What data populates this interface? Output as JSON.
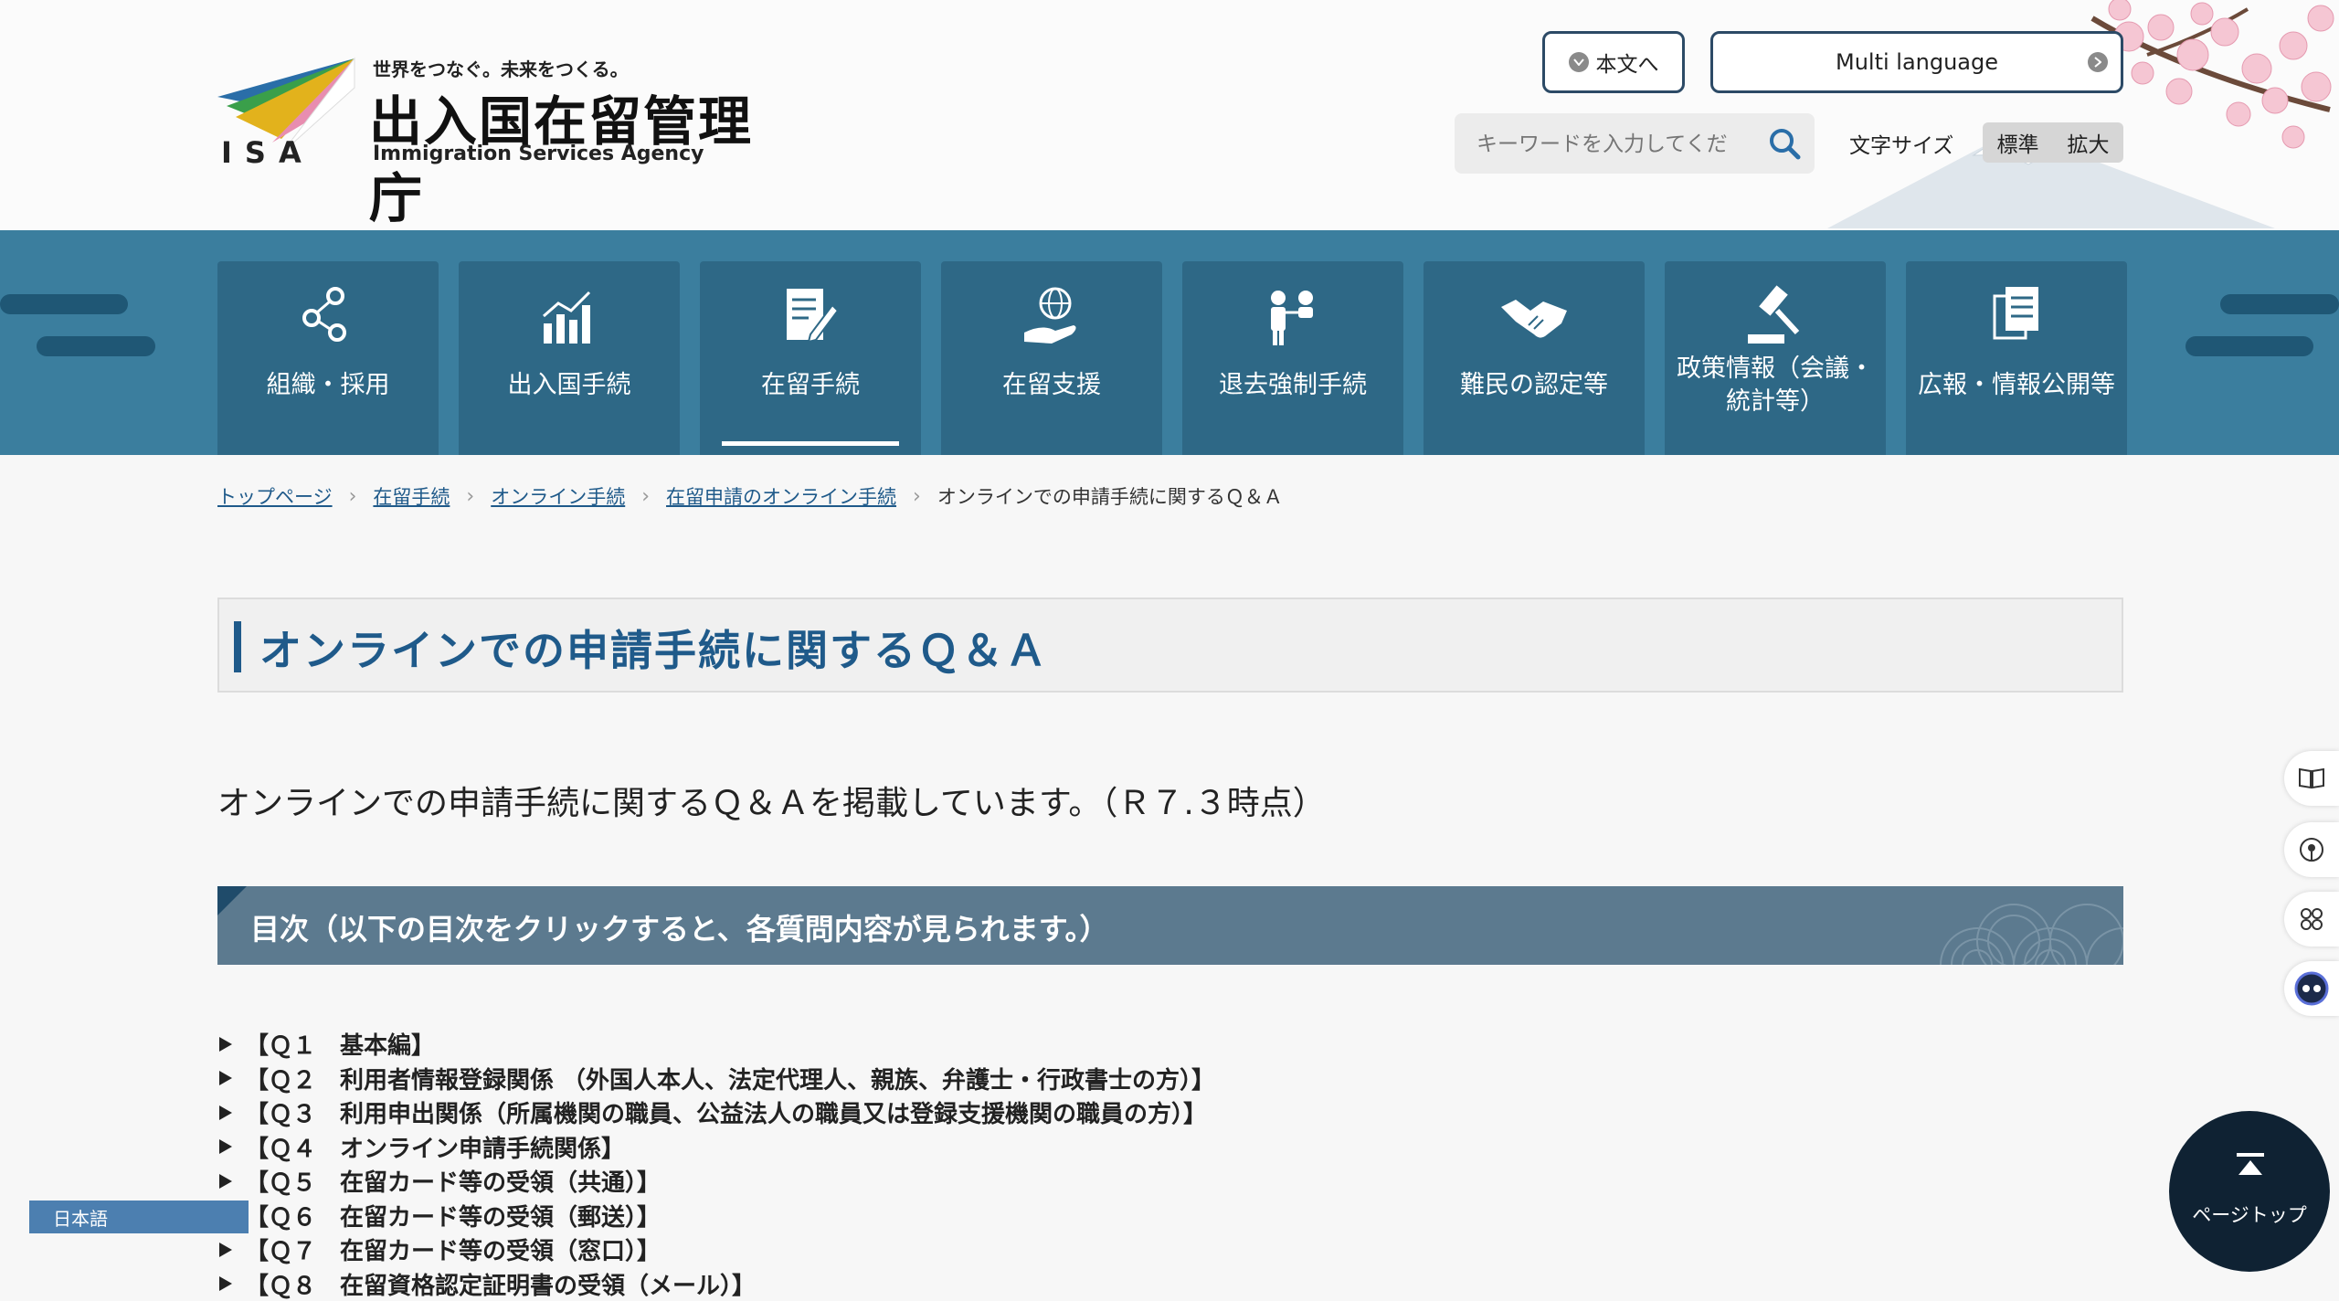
{
  "header": {
    "logo": {
      "tagline": "世界をつなぐ。未来をつくる。",
      "agency_ja": "出入国在留管理庁",
      "agency_en": "Immigration Services Agency",
      "abbr": "ISA"
    },
    "skip_label": "本文へ",
    "multi_language_label": "Multi language",
    "search": {
      "placeholder": "キーワードを入力してくだ"
    },
    "fontsize": {
      "label": "文字サイズ",
      "standard": "標準",
      "large": "拡大"
    }
  },
  "nav": {
    "items": [
      {
        "label": "組織・採用",
        "icon": "organization-icon"
      },
      {
        "label": "出入国手続",
        "icon": "chart-icon"
      },
      {
        "label": "在留手続",
        "icon": "document-pen-icon",
        "active": true
      },
      {
        "label": "在留支援",
        "icon": "globe-hand-icon"
      },
      {
        "label": "退去強制手続",
        "icon": "people-icon"
      },
      {
        "label": "難民の認定等",
        "icon": "handshake-icon"
      },
      {
        "label_line1": "政策情報（会議・",
        "label_line2": "統計等）",
        "icon": "gavel-icon"
      },
      {
        "label": "広報・情報公開等",
        "icon": "documents-icon"
      }
    ]
  },
  "breadcrumb": {
    "items": [
      "トップページ",
      "在留手続",
      "オンライン手続",
      "在留申請のオンライン手続"
    ],
    "current": "オンラインでの申請手続に関するＱ＆Ａ"
  },
  "page": {
    "title": "オンラインでの申請手続に関するＱ＆Ａ",
    "lead": "オンラインでの申請手続に関するＱ＆Ａを掲載しています。（Ｒ７.３時点）",
    "toc_heading": "目次（以下の目次をクリックすると、各質問内容が見られます。）",
    "toc": [
      "【Ｑ１　基本編】",
      "【Ｑ２　利用者情報登録関係 （外国人本人、法定代理人、親族、弁護士・行政書士の方）】",
      "【Ｑ３　利用申出関係（所属機関の職員、公益法人の職員又は登録支援機関の職員の方）】",
      "【Ｑ４　オンライン申請手続関係】",
      "【Ｑ５　在留カード等の受領（共通）】",
      "【Ｑ６　在留カード等の受領（郵送）】",
      "【Ｑ７　在留カード等の受領（窓口）】",
      "【Ｑ８　在留資格認定証明書の受領（メール）】"
    ]
  },
  "widgets": {
    "page_top_label": "ページトップ",
    "language_tab_label": "日本語",
    "side_icons": [
      "book-icon",
      "audio-icon",
      "apps-icon",
      "assistant-icon"
    ]
  },
  "colors": {
    "nav_bg": "#3b7e9e",
    "nav_item_bg": "#2e6886",
    "title_color": "#1f5a8a",
    "toc_head_bg": "#5c7a8f"
  }
}
